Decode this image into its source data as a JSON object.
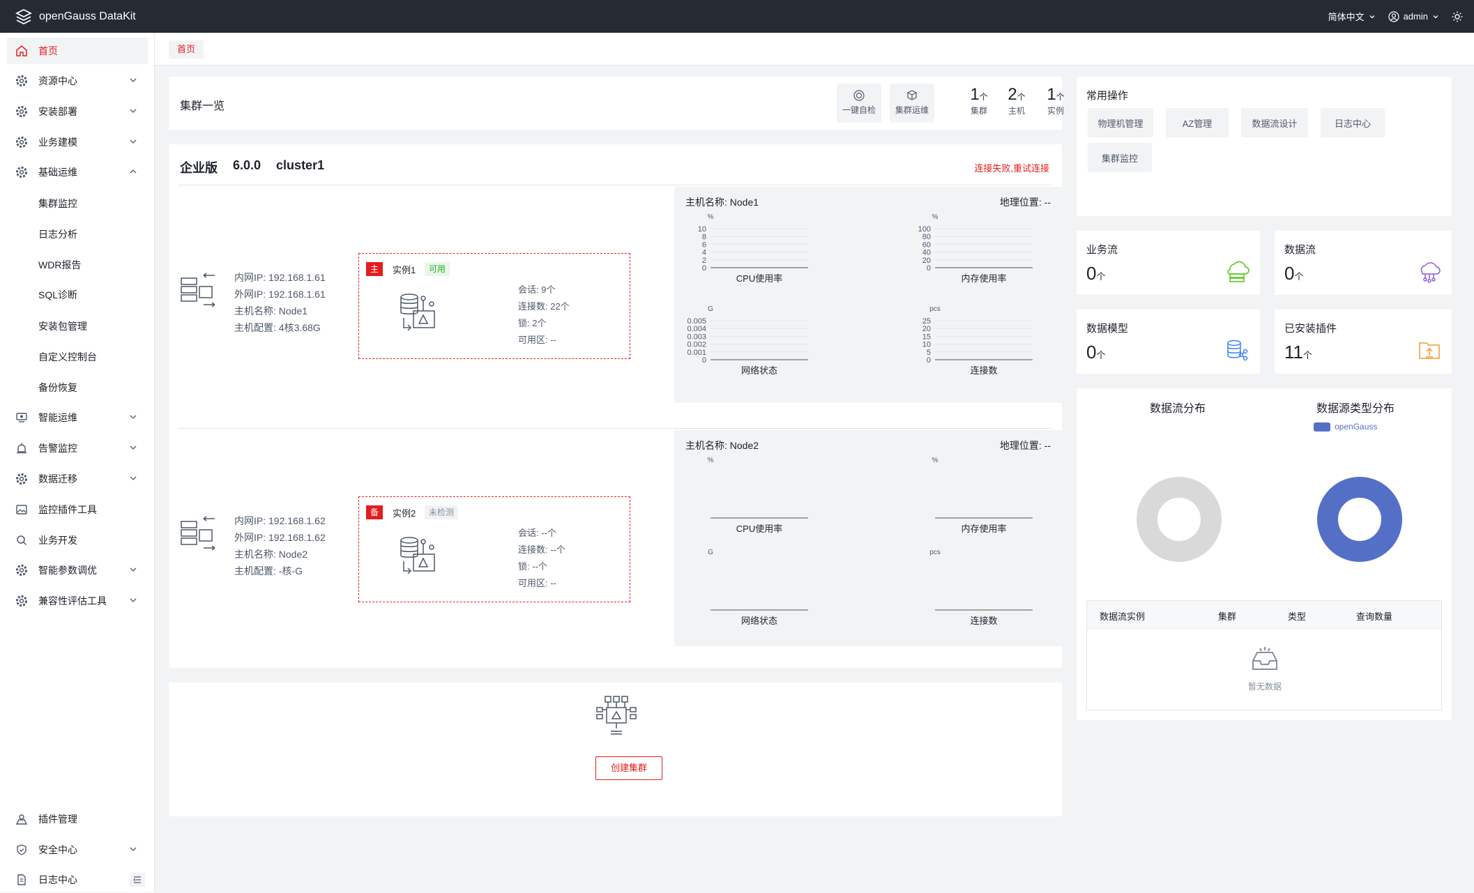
{
  "app": {
    "title": "openGauss DataKit",
    "language": "简体中文",
    "user": "admin"
  },
  "colors": {
    "accent": "#e41d1d",
    "topbar": "#262a33",
    "donut_blue": "#5470c6",
    "donut_gray": "#d9d9d9",
    "green": "#52c41a",
    "purple": "#8e59d9",
    "orange": "#f09a2a",
    "blue": "#3b82f6"
  },
  "sidebar": {
    "items": [
      {
        "label": "首页",
        "icon": "home-icon"
      },
      {
        "label": "资源中心",
        "icon": "gear-icon"
      },
      {
        "label": "安装部署",
        "icon": "gear-icon"
      },
      {
        "label": "业务建模",
        "icon": "gear-icon"
      },
      {
        "label": "基础运维",
        "icon": "gear-icon"
      },
      {
        "label": "智能运维",
        "icon": "monitor-icon"
      },
      {
        "label": "告警监控",
        "icon": "alarm-icon"
      },
      {
        "label": "数据迁移",
        "icon": "gear-icon"
      },
      {
        "label": "监控插件工具",
        "icon": "image-icon"
      },
      {
        "label": "业务开发",
        "icon": "search-icon"
      },
      {
        "label": "智能参数调优",
        "icon": "gear-icon"
      },
      {
        "label": "兼容性评估工具",
        "icon": "gear-icon"
      },
      {
        "label": "插件管理",
        "icon": "plugin-icon"
      },
      {
        "label": "安全中心",
        "icon": "shield-icon"
      },
      {
        "label": "日志中心",
        "icon": "document-icon"
      }
    ],
    "subitems": [
      "集群监控",
      "日志分析",
      "WDR报告",
      "SQL诊断",
      "安装包管理",
      "自定义控制台",
      "备份恢复"
    ]
  },
  "breadcrumb": "首页",
  "overview": {
    "title": "集群一览",
    "btn_check": "一键自检",
    "btn_ops": "集群运维",
    "stats": [
      {
        "num": "1",
        "unit": "个",
        "label": "集群"
      },
      {
        "num": "2",
        "unit": "个",
        "label": "主机"
      },
      {
        "num": "1",
        "unit": "个",
        "label": "实例"
      }
    ]
  },
  "cluster": {
    "edition": "企业版",
    "version": "6.0.0",
    "name": "cluster1",
    "status": "连接失败,重试连接",
    "nodes": [
      {
        "inner_ip": "内网IP:  192.168.1.61",
        "outer_ip": "外网IP:  192.168.1.61",
        "host_name": "主机名称:  Node1",
        "host_cfg": "主机配置:  4核3.68G",
        "role": "主",
        "instance": "实例1",
        "inst_state": "可用",
        "session": "会话:  9个",
        "conns": "连接数:  22个",
        "lock": "锁:  2个",
        "zone": "可用区:  --",
        "panel_host": "主机名称: Node1",
        "panel_geo": "地理位置: --"
      },
      {
        "inner_ip": "内网IP:  192.168.1.62",
        "outer_ip": "外网IP:  192.168.1.62",
        "host_name": "主机名称:  Node2",
        "host_cfg": "主机配置:  -核-G",
        "role": "备",
        "instance": "实例2",
        "inst_state": "未检测",
        "session": "会话:  --个",
        "conns": "连接数:  --个",
        "lock": "锁:  --个",
        "zone": "可用区:  --",
        "panel_host": "主机名称: Node2",
        "panel_geo": "地理位置: --"
      }
    ]
  },
  "chart_data": [
    {
      "type": "line",
      "title": "CPU使用率",
      "ylabel": "%",
      "ylim": [
        0,
        10
      ],
      "yticks": [
        "10",
        "8",
        "6",
        "4",
        "2",
        "0"
      ],
      "series": []
    },
    {
      "type": "line",
      "title": "内存使用率",
      "ylabel": "%",
      "ylim": [
        0,
        100
      ],
      "yticks": [
        "100",
        "80",
        "60",
        "40",
        "20",
        "0"
      ],
      "series": []
    },
    {
      "type": "line",
      "title": "网络状态",
      "ylabel": "G",
      "ylim": [
        0,
        0.005
      ],
      "yticks": [
        "0.005",
        "0.004",
        "0.003",
        "0.002",
        "0.001",
        "0"
      ],
      "series": []
    },
    {
      "type": "line",
      "title": "连接数",
      "ylabel": "pcs",
      "ylim": [
        0,
        25
      ],
      "yticks": [
        "25",
        "20",
        "15",
        "10",
        "5",
        "0"
      ],
      "series": []
    },
    {
      "type": "line",
      "title": "CPU使用率",
      "ylabel": "%",
      "series": []
    },
    {
      "type": "line",
      "title": "内存使用率",
      "ylabel": "%",
      "series": []
    },
    {
      "type": "line",
      "title": "网络状态",
      "ylabel": "G",
      "series": []
    },
    {
      "type": "line",
      "title": "连接数",
      "ylabel": "pcs",
      "series": []
    },
    {
      "type": "pie",
      "title": "数据流分布",
      "series": []
    },
    {
      "type": "pie",
      "title": "数据源类型分布",
      "legend": [
        "openGauss"
      ],
      "series": [
        {
          "name": "openGauss",
          "values": [
            1
          ]
        }
      ]
    }
  ],
  "create_cluster": "创建集群",
  "ops": {
    "title": "常用操作",
    "buttons": [
      "物理机管理",
      "AZ管理",
      "数据流设计",
      "日志中心",
      "集群监控"
    ]
  },
  "stat_cards": [
    {
      "label": "业务流",
      "value": "0",
      "unit": "个"
    },
    {
      "label": "数据流",
      "value": "0",
      "unit": "个"
    },
    {
      "label": "数据模型",
      "value": "0",
      "unit": "个"
    },
    {
      "label": "已安装插件",
      "value": "11",
      "unit": "个"
    }
  ],
  "dist": {
    "title1": "数据流分布",
    "title2": "数据源类型分布",
    "legend": "openGauss"
  },
  "table": {
    "headers": [
      "数据流实例",
      "集群",
      "类型",
      "查询数量"
    ],
    "empty": "暂无数据"
  }
}
